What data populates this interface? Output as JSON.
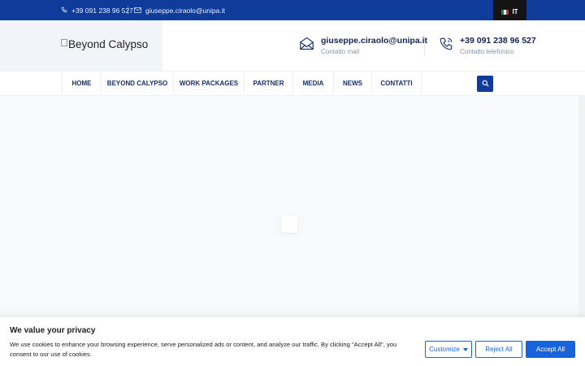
{
  "topbar": {
    "phone": "+39 091 238 96 527",
    "email": "giuseppe.ciraolo@unipa.it",
    "language": "IT"
  },
  "header": {
    "logo_alt": "Beyond Calypso",
    "email_main": "giuseppe.ciraolo@unipa.it",
    "email_sub": "Contatto mail",
    "phone_main": "+39 091 238 96 527",
    "phone_sub": "Contatto telefonico"
  },
  "nav": {
    "items": [
      {
        "label": "HOME"
      },
      {
        "label": "BEYOND CALYPSO"
      },
      {
        "label": "WORK PACKAGES"
      },
      {
        "label": "PARTNER"
      },
      {
        "label": "MEDIA"
      },
      {
        "label": "NEWS"
      },
      {
        "label": "CONTATTI"
      }
    ]
  },
  "cookie": {
    "title": "We value your privacy",
    "text": "We use cookies to enhance your browsing experience, serve personalized ads or content, and analyze our traffic. By clicking \"Accept All\", you consent to our use of cookies.",
    "customize": "Customize",
    "reject": "Reject All",
    "accept": "Accept All"
  },
  "colors": {
    "brand_blue": "#0f3b9a",
    "cookie_blue": "#1863dc",
    "flag_green": "#009246",
    "flag_white": "#ffffff",
    "flag_red": "#ce2b37"
  },
  "icons": [
    "phone-icon",
    "mail-icon",
    "envelope-icon",
    "search-icon",
    "chevron-down-icon"
  ]
}
